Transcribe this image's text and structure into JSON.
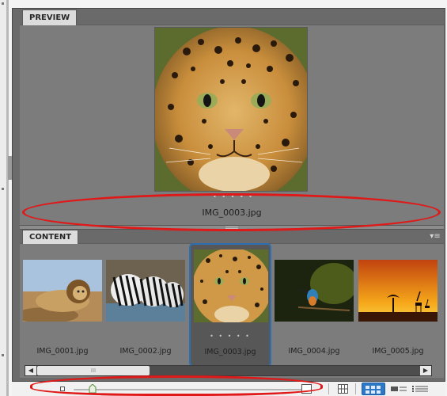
{
  "preview": {
    "tab_label": "PREVIEW",
    "filename": "IMG_0003.jpg",
    "rating_dots": "• • • • •"
  },
  "content": {
    "tab_label": "CONTENT",
    "menu_icon": "panel-menu-icon",
    "thumbnails": [
      {
        "label": "IMG_0001.jpg",
        "subject": "lion",
        "selected": false
      },
      {
        "label": "IMG_0002.jpg",
        "subject": "zebras",
        "selected": false
      },
      {
        "label": "IMG_0003.jpg",
        "subject": "leopard",
        "selected": true,
        "rating_dots": "• • • • •"
      },
      {
        "label": "IMG_0004.jpg",
        "subject": "kingfisher",
        "selected": false
      },
      {
        "label": "IMG_0005.jpg",
        "subject": "giraffe-sunset",
        "selected": false
      }
    ],
    "scrollbar_thumb_grip": "III"
  },
  "toolbar": {
    "zoom_level": 0.08,
    "view_modes": [
      "grid-view",
      "thumbnail-view",
      "details-view",
      "list-view"
    ],
    "active_view": "thumbnail-view"
  },
  "colors": {
    "panel_bg": "#7c7c7c",
    "selection_border": "#2d6fb2",
    "annotation": "#e01818",
    "active_view_button": "#2f78c8"
  }
}
